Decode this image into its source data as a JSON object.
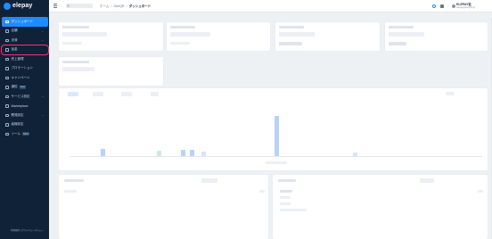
{
  "brand": {
    "name": "elepay"
  },
  "sidebar": {
    "items": [
      {
        "label": "ダッシュボード",
        "icon": "dashboard-icon",
        "active": true
      },
      {
        "label": "店舗",
        "icon": "store-icon",
        "chevron": "⌄"
      },
      {
        "label": "決済",
        "icon": "payment-icon",
        "chevron": "⌄"
      },
      {
        "label": "返金",
        "icon": "refund-icon",
        "highlight": true
      },
      {
        "label": "売上管理",
        "icon": "sales-icon"
      },
      {
        "label": "プロモーション",
        "icon": "promotion-icon"
      },
      {
        "label": "キャンペーン",
        "icon": "campaign-icon"
      },
      {
        "label": "通知",
        "icon": "notice-icon",
        "badge": "NEW"
      },
      {
        "label": "サービス設定",
        "icon": "service-settings-icon",
        "chevron": "⌄"
      },
      {
        "label": "Marketplace",
        "icon": "marketplace-icon"
      },
      {
        "label": "開発設定",
        "icon": "developer-icon",
        "chevron": "⌄"
      },
      {
        "label": "組織設定",
        "icon": "organization-icon"
      },
      {
        "label": "ツール",
        "icon": "tool-icon",
        "badge": "NEW"
      }
    ],
    "footer": "利用規約 | プライバシーポリシー"
  },
  "topbar": {
    "breadcrumb": [
      "ホーム",
      "OneQR",
      "ダッシュボード"
    ],
    "user_name": "ELEPAY社",
    "user_sub": "elepay@elestyle.jp"
  },
  "colors": {
    "sidebar_bg": "#0f2238",
    "accent": "#1f8bff",
    "highlight": "#ff2f6d"
  }
}
